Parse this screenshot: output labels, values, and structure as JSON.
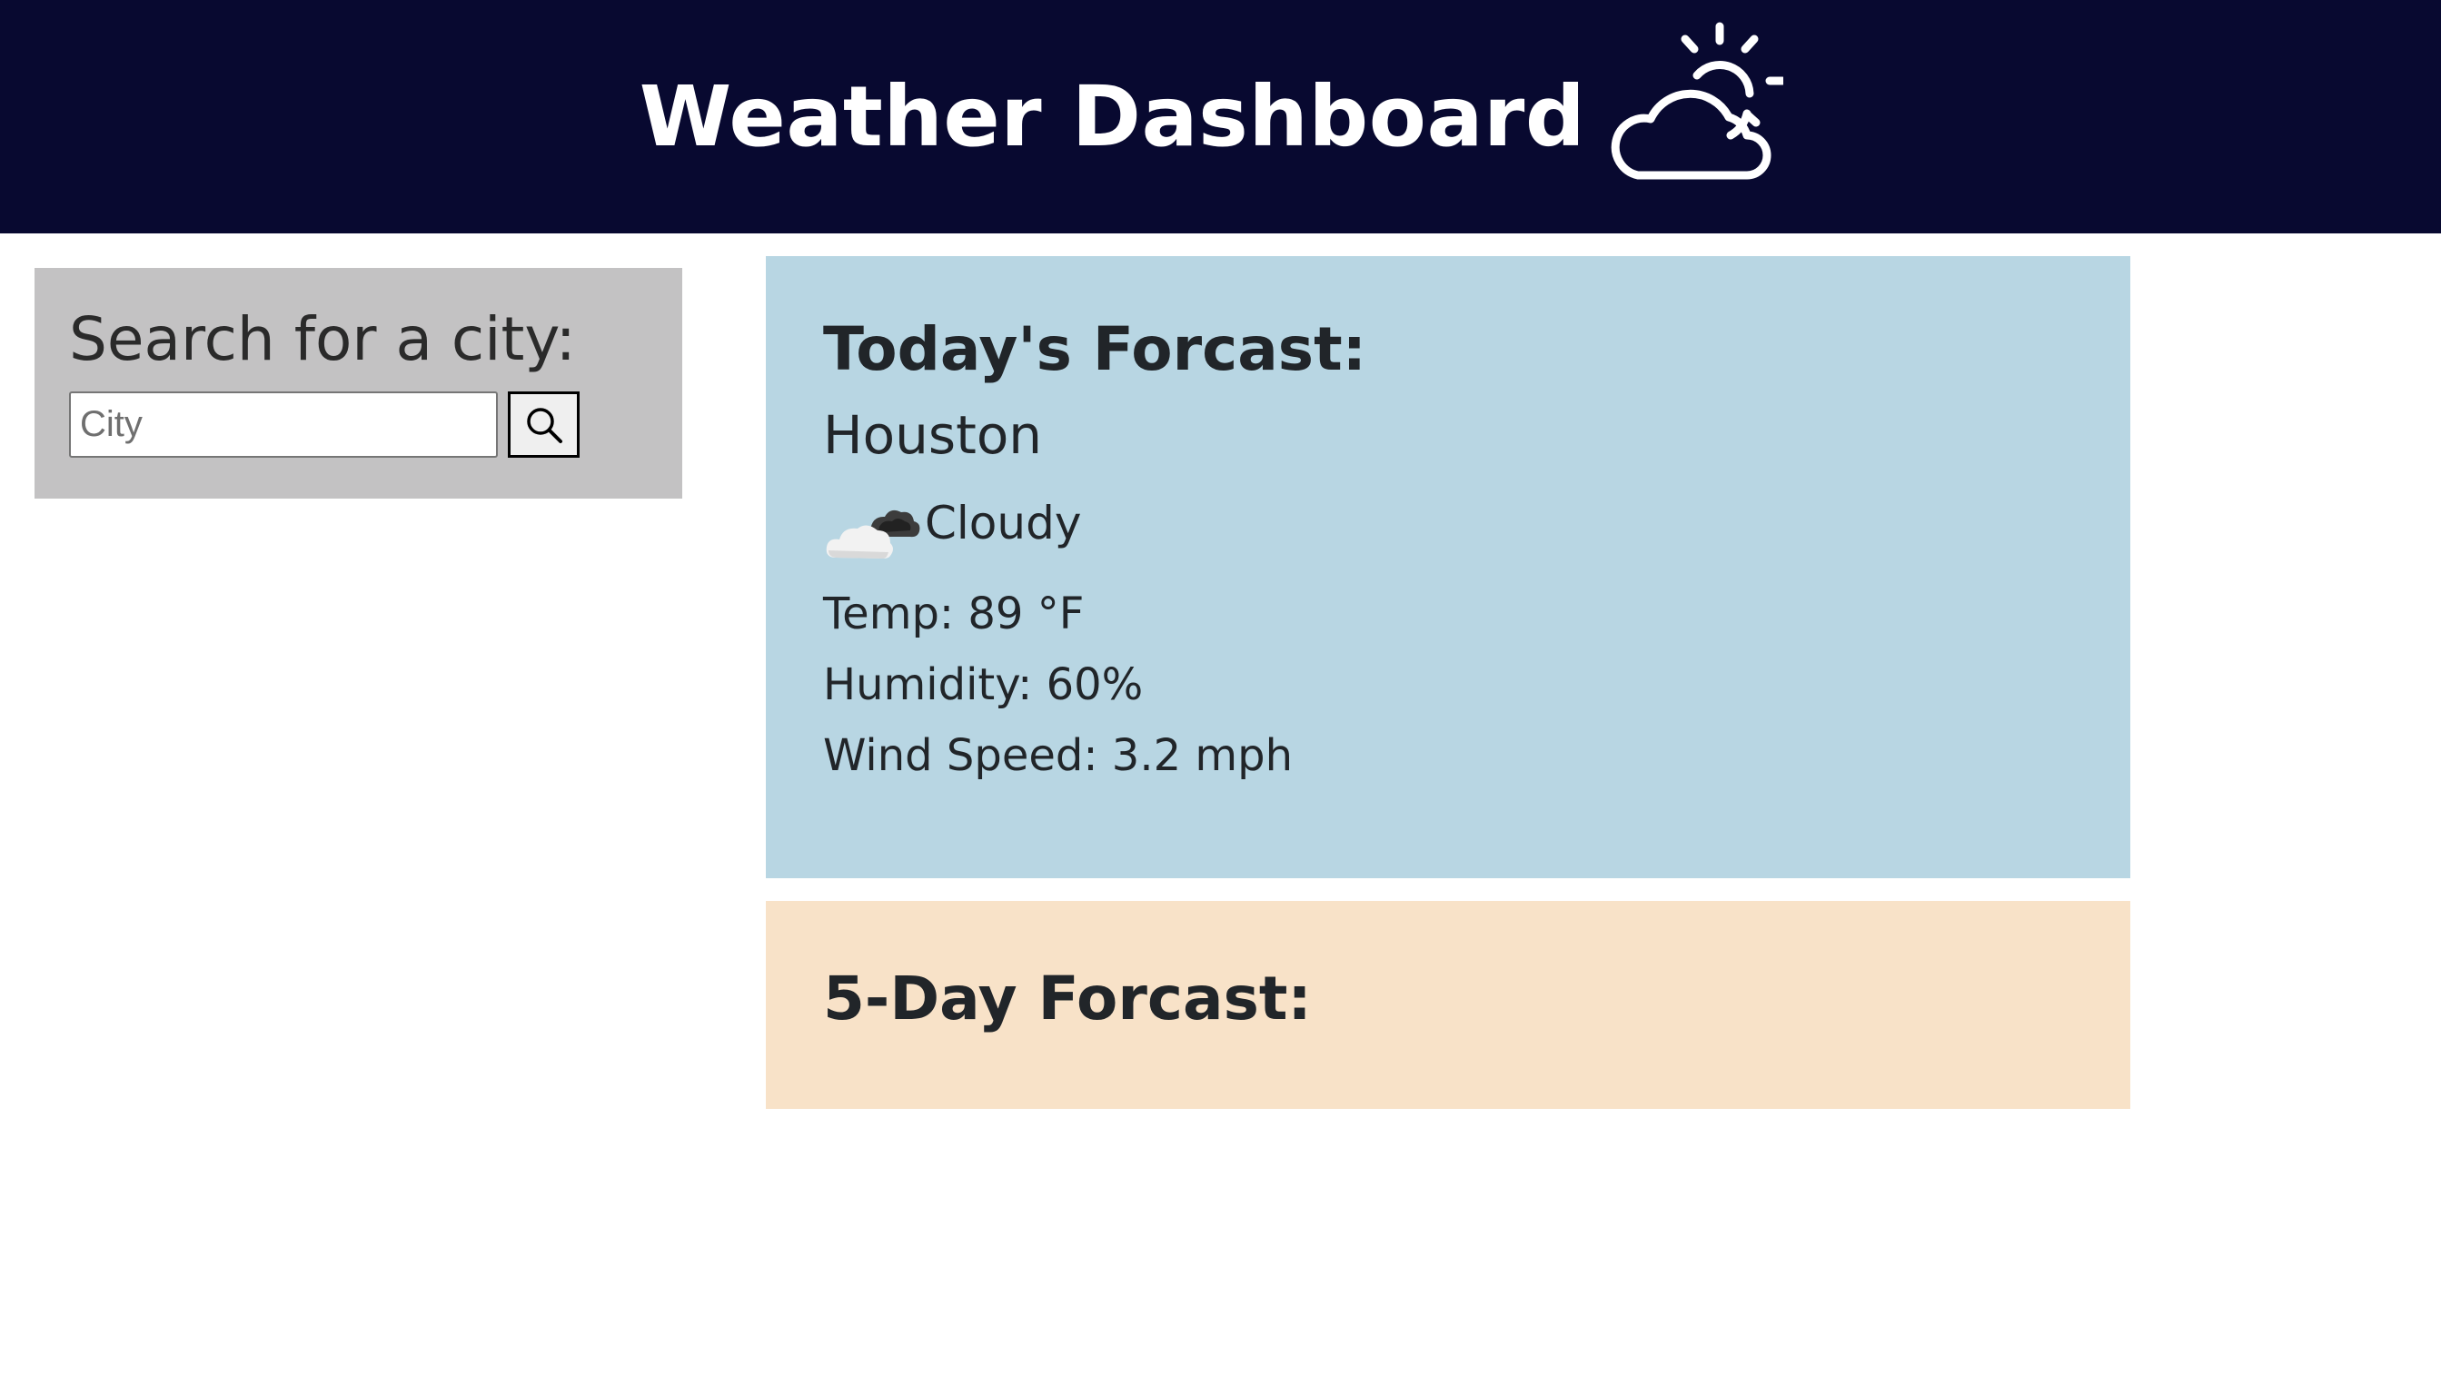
{
  "header": {
    "title": "Weather Dashboard",
    "icon": "partly-cloudy-icon"
  },
  "search": {
    "title": "Search for a city:",
    "placeholder": "City",
    "value": "",
    "button_icon": "search-icon"
  },
  "today": {
    "title": "Today's Forcast:",
    "city": "Houston",
    "condition_icon": "cloudy-icon",
    "condition": "Cloudy",
    "temp": "Temp: 89 °F",
    "humidity": "Humidity: 60%",
    "wind": "Wind Speed: 3.2 mph"
  },
  "five_day": {
    "title": "5-Day Forcast:"
  },
  "colors": {
    "header_bg": "#080930",
    "search_bg": "#c3c2c3",
    "today_bg": "#b8d6e3",
    "five_day_bg": "#f8e2c8"
  }
}
